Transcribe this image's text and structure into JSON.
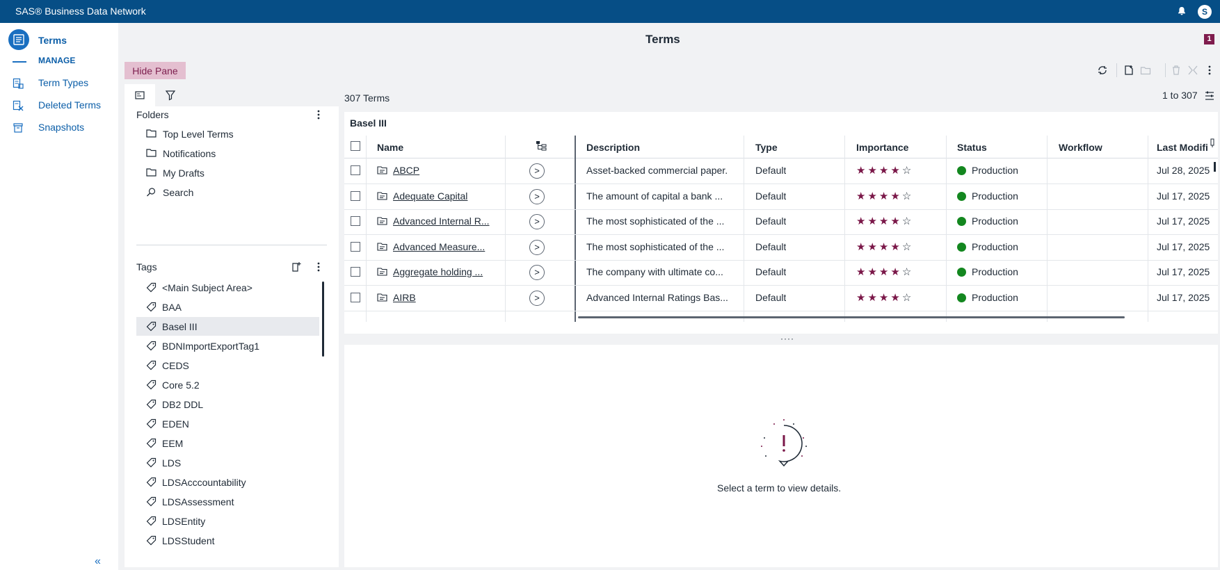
{
  "app": {
    "title": "SAS® Business Data Network",
    "avatar_initial": "S"
  },
  "nav": {
    "main_label": "Terms",
    "manage_label": "MANAGE",
    "items": [
      {
        "label": "Term Types",
        "icon": "term-types-icon"
      },
      {
        "label": "Deleted Terms",
        "icon": "deleted-terms-icon"
      },
      {
        "label": "Snapshots",
        "icon": "snapshots-icon"
      }
    ],
    "collapse_glyph": "«"
  },
  "page": {
    "title": "Terms",
    "notification_count": "1"
  },
  "pane": {
    "hide_label": "Hide Pane",
    "folders_title": "Folders",
    "folders": [
      "Top Level Terms",
      "Notifications",
      "My Drafts",
      "Search"
    ],
    "tags_title": "Tags",
    "tags": [
      "<Main Subject Area>",
      "BAA",
      "Basel III",
      "BDNImportExportTag1",
      "CEDS",
      "Core 5.2",
      "DB2 DDL",
      "EDEN",
      "EEM",
      "LDS",
      "LDSAcccountability",
      "LDSAssessment",
      "LDSEntity",
      "LDSStudent"
    ],
    "selected_tag": "Basel III"
  },
  "grid": {
    "count_label": "307 Terms",
    "range_label": "1 to 307",
    "caption": "Basel III",
    "columns": [
      "Name",
      "Description",
      "Type",
      "Importance",
      "Status",
      "Workflow",
      "Last Modifi"
    ],
    "rows": [
      {
        "name": "ABCP",
        "description": "Asset-backed commercial paper.",
        "type": "Default",
        "importance": 4,
        "status": "Production",
        "workflow": "",
        "last_modified": "Jul 28, 2025"
      },
      {
        "name": "Adequate Capital",
        "description": "The amount of capital a bank ...",
        "type": "Default",
        "importance": 4,
        "status": "Production",
        "workflow": "",
        "last_modified": "Jul 17, 2025"
      },
      {
        "name": "Advanced Internal R...",
        "description": "The most sophisticated of the ...",
        "type": "Default",
        "importance": 4,
        "status": "Production",
        "workflow": "",
        "last_modified": "Jul 17, 2025"
      },
      {
        "name": "Advanced Measure...",
        "description": "The most sophisticated of the ...",
        "type": "Default",
        "importance": 4,
        "status": "Production",
        "workflow": "",
        "last_modified": "Jul 17, 2025"
      },
      {
        "name": "Aggregate holding ...",
        "description": "The company with ultimate co...",
        "type": "Default",
        "importance": 4,
        "status": "Production",
        "workflow": "",
        "last_modified": "Jul 17, 2025"
      },
      {
        "name": "AIRB",
        "description": "Advanced Internal Ratings Bas...",
        "type": "Default",
        "importance": 4,
        "status": "Production",
        "workflow": "",
        "last_modified": "Jul 17, 2025"
      }
    ],
    "importance_max": 5,
    "status_color": "#13871f",
    "star_color": "#7a1748"
  },
  "detail": {
    "message": "Select a term to view details."
  },
  "colors": {
    "header": "#064e86",
    "accent": "#1a6fc0",
    "hide_pane_bg": "#e4bfd0"
  }
}
